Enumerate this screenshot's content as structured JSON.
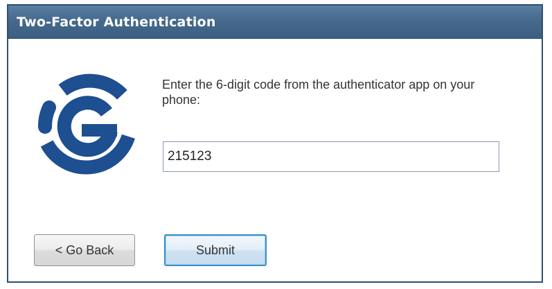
{
  "window": {
    "title": "Two-Factor Authentication"
  },
  "logo": {
    "icon": "authenticator-g-logo",
    "color": "#1d4f91"
  },
  "prompt": {
    "text": "Enter the 6-digit code from the authenticator app on your phone:"
  },
  "code_field": {
    "value": "215123"
  },
  "buttons": {
    "back_label": "< Go Back",
    "submit_label": "Submit"
  }
}
